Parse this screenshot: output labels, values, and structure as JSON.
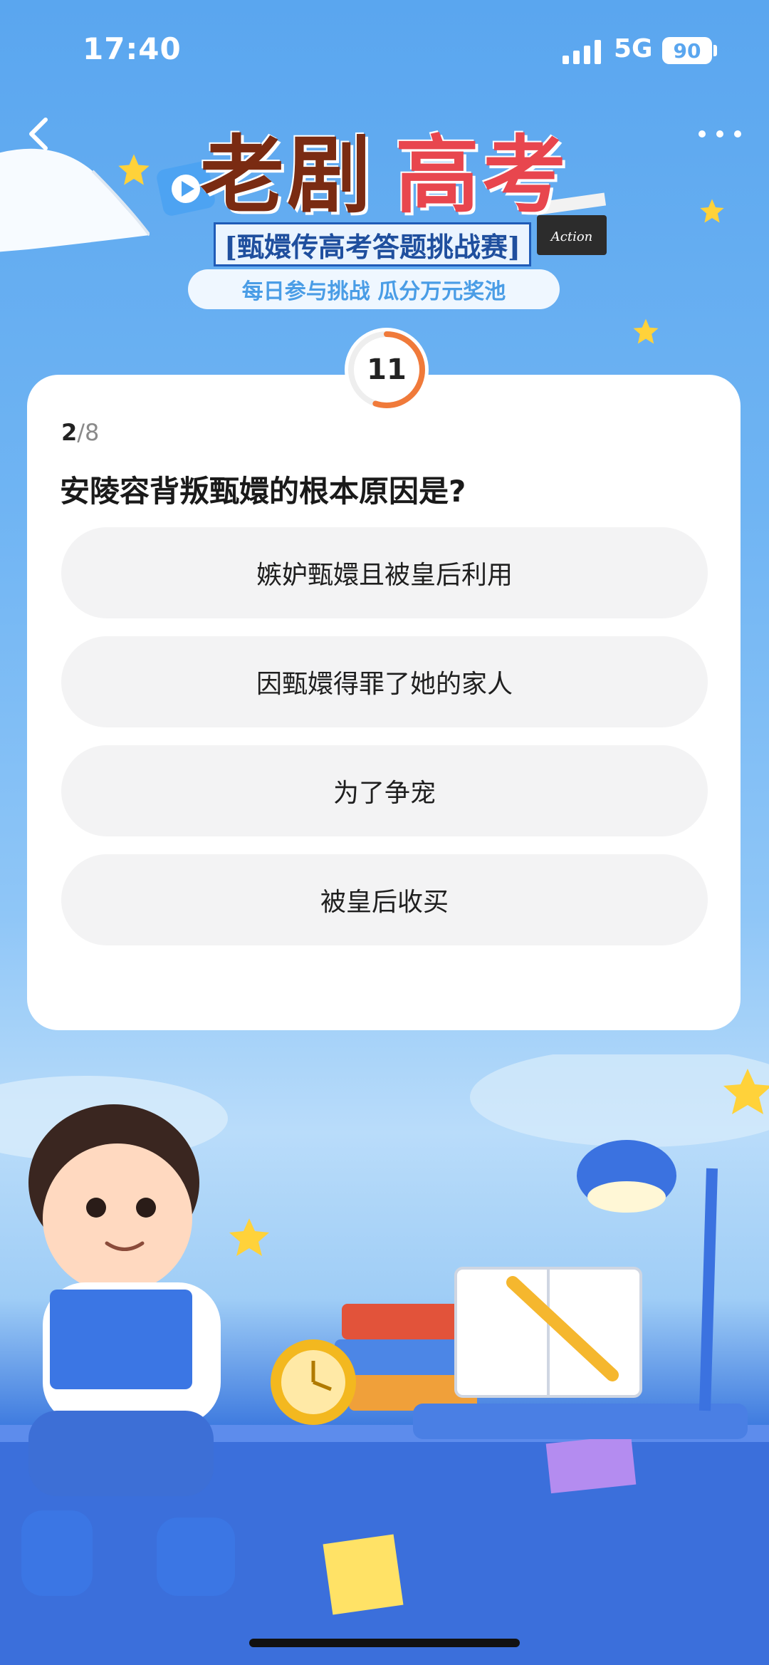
{
  "status_bar": {
    "time": "17:40",
    "network": "5G",
    "battery": "90"
  },
  "nav": {
    "back_icon": "chevron-left-icon",
    "more_icon": "more-horizontal-icon"
  },
  "banner": {
    "title_part1": "老剧",
    "title_part2": "高考",
    "subtitle": "[甄嬛传高考答题挑战赛]",
    "clapper_text": "Action",
    "tagline": "每日参与挑战 瓜分万元奖池"
  },
  "quiz": {
    "timer": "11",
    "timer_fraction_remaining": 0.55,
    "progress_current": "2",
    "progress_total": "/8",
    "question": "安陵容背叛甄嬛的根本原因是?",
    "options": [
      {
        "label": "嫉妒甄嬛且被皇后利用"
      },
      {
        "label": "因甄嬛得罪了她的家人"
      },
      {
        "label": "为了争宠"
      },
      {
        "label": "被皇后收买"
      }
    ]
  },
  "colors": {
    "accent_timer": "#f07a3a",
    "card_bg": "#ffffff",
    "option_bg": "#f3f3f4",
    "tagline_text": "#4a9de6"
  }
}
